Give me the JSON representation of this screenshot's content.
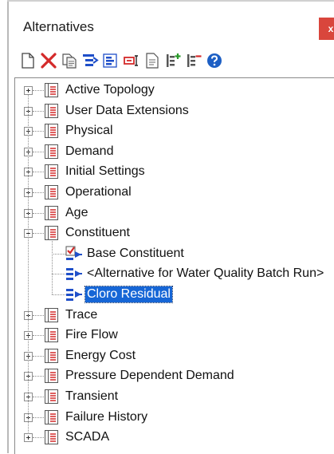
{
  "window": {
    "title": "Alternatives",
    "close_label": "x"
  },
  "toolbar": {
    "buttons": [
      {
        "icon": "new-document-icon",
        "tooltip": ""
      },
      {
        "icon": "delete-icon",
        "tooltip": ""
      },
      {
        "icon": "duplicate-icon",
        "tooltip": ""
      },
      {
        "icon": "new-child-icon",
        "tooltip": ""
      },
      {
        "icon": "merge-icon",
        "tooltip": ""
      },
      {
        "icon": "rename-icon",
        "tooltip": ""
      },
      {
        "icon": "report-icon",
        "tooltip": ""
      },
      {
        "icon": "expand-all-icon",
        "tooltip": ""
      },
      {
        "icon": "collapse-all-icon",
        "tooltip": ""
      },
      {
        "icon": "help-icon",
        "tooltip": ""
      }
    ]
  },
  "tree": {
    "items": [
      {
        "label": "Active Topology",
        "expanded": false
      },
      {
        "label": "User Data Extensions",
        "expanded": false
      },
      {
        "label": "Physical",
        "expanded": false
      },
      {
        "label": "Demand",
        "expanded": false
      },
      {
        "label": "Initial Settings",
        "expanded": false
      },
      {
        "label": "Operational",
        "expanded": false
      },
      {
        "label": "Age",
        "expanded": false
      },
      {
        "label": "Constituent",
        "expanded": true,
        "children": [
          {
            "label": "Base Constituent",
            "icon": "checked-alternative-icon",
            "selected": false
          },
          {
            "label": "<Alternative for Water Quality Batch Run>",
            "icon": "child-alternative-icon",
            "selected": false
          },
          {
            "label": "Cloro Residual",
            "icon": "child-alternative-icon",
            "selected": true
          }
        ]
      },
      {
        "label": "Trace",
        "expanded": false
      },
      {
        "label": "Fire Flow",
        "expanded": false
      },
      {
        "label": "Energy Cost",
        "expanded": false
      },
      {
        "label": "Pressure Dependent Demand",
        "expanded": false
      },
      {
        "label": "Transient",
        "expanded": false
      },
      {
        "label": "Failure History",
        "expanded": false
      },
      {
        "label": "SCADA",
        "expanded": false
      }
    ]
  },
  "colors": {
    "selection": "#1666d6",
    "close_button": "#d9463c",
    "icon_red": "#d42a2a",
    "icon_blue": "#1f4fc9",
    "help_blue": "#1d5fc4"
  }
}
